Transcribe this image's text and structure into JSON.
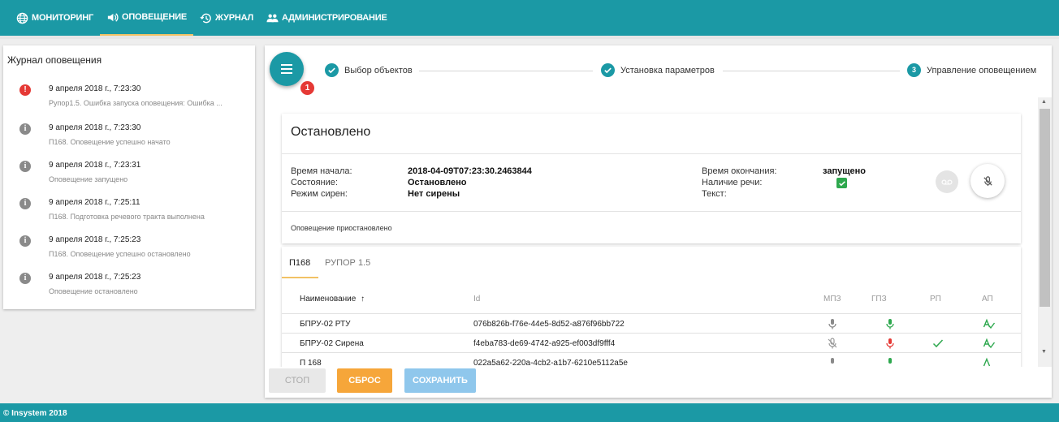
{
  "nav": {
    "items": [
      {
        "label": "МОНИТОРИНГ",
        "icon": "globe-icon"
      },
      {
        "label": "ОПОВЕЩЕНИЕ",
        "icon": "speaker-icon"
      },
      {
        "label": "ЖУРНАЛ",
        "icon": "history-icon"
      },
      {
        "label": "АДМИНИСТРИРОВАНИЕ",
        "icon": "users-icon"
      }
    ]
  },
  "sidebar": {
    "title": "Журнал оповещения",
    "items": [
      {
        "date": "9 апреля 2018 г., 7:23:30",
        "text": "Рупор1.5. Ошибка запуска оповещения: Ошибка ...",
        "type": "error",
        "icon": "!"
      },
      {
        "date": "9 апреля 2018 г., 7:23:30",
        "text": "П168. Оповещение успешно начато",
        "type": "info",
        "icon": "i"
      },
      {
        "date": "9 апреля 2018 г., 7:23:31",
        "text": "Оповещение запущено",
        "type": "info",
        "icon": "i"
      },
      {
        "date": "9 апреля 2018 г., 7:25:11",
        "text": "П168. Подготовка речевого тракта выполнена",
        "type": "info",
        "icon": "i"
      },
      {
        "date": "9 апреля 2018 г., 7:25:23",
        "text": "П168. Оповещение успешно остановлено",
        "type": "info",
        "icon": "i"
      },
      {
        "date": "9 апреля 2018 г., 7:25:23",
        "text": "Оповещение остановлено",
        "type": "info",
        "icon": "i"
      }
    ]
  },
  "stepper": {
    "badge": "1",
    "steps": [
      {
        "label": "Выбор объектов",
        "state": "done"
      },
      {
        "label": "Установка параметров",
        "state": "done"
      },
      {
        "label": "Управление оповещением",
        "state": "current",
        "number": "3"
      }
    ]
  },
  "status_card": {
    "title": "Остановлено",
    "fields": {
      "start_label": "Время начала:",
      "start_value": "2018-04-09T07:23:30.2463844",
      "state_label": "Состояние:",
      "state_value": "Остановлено",
      "siren_label": "Режим сирен:",
      "siren_value": "Нет сирены",
      "end_label": "Время окончания:",
      "end_value": "запущено",
      "speech_label": "Наличие речи:",
      "speech_checked": true,
      "text_label": "Текст:",
      "text_value": ""
    },
    "note": "Оповещение приостановлено"
  },
  "table_card": {
    "tabs": [
      "П168",
      "РУПОР 1.5"
    ],
    "active_tab": 0,
    "columns": {
      "name": "Наименование",
      "id": "Id",
      "mpz": "МПЗ",
      "gpz": "ГПЗ",
      "rp": "РП",
      "ap": "АП"
    },
    "rows": [
      {
        "name": "БПРУ-02 РТУ",
        "id": "076b826b-f76e-44e5-8d52-a876f96bb722",
        "mpz": "mic-gray",
        "gpz": "mic-green",
        "rp": "",
        "ap": "signal-green"
      },
      {
        "name": "БПРУ-02 Сирена",
        "id": "f4eba783-de69-4742-a925-ef003df9fff4",
        "mpz": "mic-off-gray",
        "gpz": "mic-red",
        "rp": "check-green",
        "ap": "signal-green"
      },
      {
        "name": "П 168",
        "id": "022a5a62-220a-4cb2-a1b7-6210e5112a5e",
        "mpz": "mic-gray",
        "gpz": "mic-green",
        "rp": "",
        "ap": "signal-green"
      }
    ]
  },
  "buttons": {
    "stop": "СТОП",
    "reset": "СБРОС",
    "save": "СОХРАНИТЬ"
  },
  "footer": {
    "text": "© Insystem 2018"
  },
  "colors": {
    "primary": "#1b99a5",
    "accent": "#f2c265",
    "error": "#e53935",
    "success": "#2ea84e",
    "reset_button": "#f6a63a",
    "save_button": "#8fc7ec"
  }
}
